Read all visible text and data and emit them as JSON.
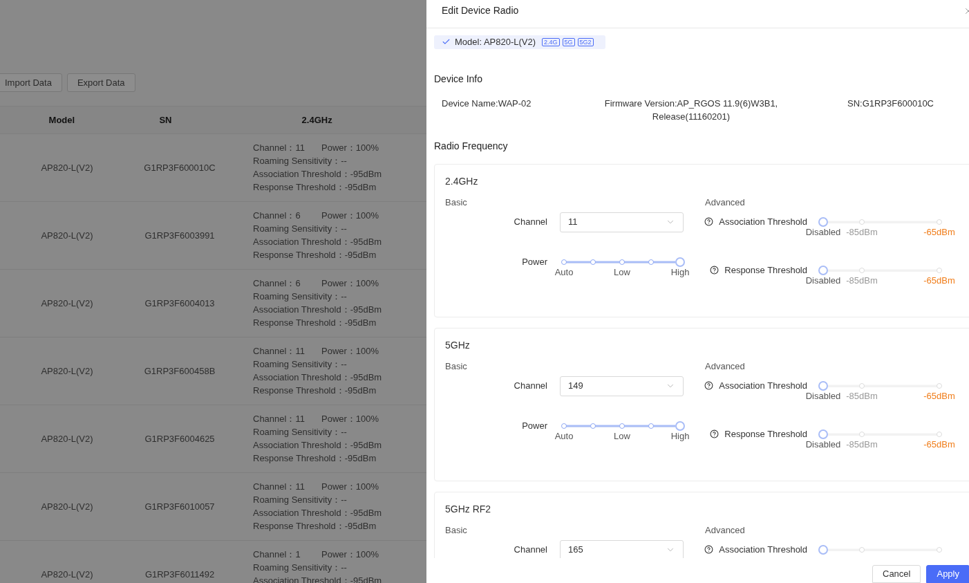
{
  "toolbar": {
    "buttons": [
      "Import Data",
      "Export Data"
    ]
  },
  "table": {
    "columns": [
      "Model",
      "SN",
      "2.4GHz"
    ],
    "rows": [
      {
        "model": "AP820-L(V2)",
        "sn": "G1RP3F600010C",
        "details": [
          "Channel：11",
          "Power：100%",
          "Roaming Sensitivity：--",
          "Association Threshold：-95dBm",
          "Response Threshold：-95dBm"
        ]
      },
      {
        "model": "AP820-L(V2)",
        "sn": "G1RP3F6003991",
        "details": [
          "Channel：6",
          "Power：100%",
          "Roaming Sensitivity：--",
          "Association Threshold：-95dBm",
          "Response Threshold：-95dBm"
        ]
      },
      {
        "model": "AP820-L(V2)",
        "sn": "G1RP3F6004013",
        "details": [
          "Channel：6",
          "Power：100%",
          "Roaming Sensitivity：--",
          "Association Threshold：-95dBm",
          "Response Threshold：-95dBm"
        ]
      },
      {
        "model": "AP820-L(V2)",
        "sn": "G1RP3F600458B",
        "details": [
          "Channel：11",
          "Power：100%",
          "Roaming Sensitivity：--",
          "Association Threshold：-95dBm",
          "Response Threshold：-95dBm"
        ]
      },
      {
        "model": "AP820-L(V2)",
        "sn": "G1RP3F6004625",
        "details": [
          "Channel：11",
          "Power：100%",
          "Roaming Sensitivity：--",
          "Association Threshold：-95dBm",
          "Response Threshold：-95dBm"
        ]
      },
      {
        "model": "AP820-L(V2)",
        "sn": "G1RP3F6010057",
        "details": [
          "Channel：11",
          "Power：100%",
          "Roaming Sensitivity：--",
          "Association Threshold：-95dBm",
          "Response Threshold：-95dBm"
        ]
      },
      {
        "model": "AP820-L(V2)",
        "sn": "G1RP3F6011492",
        "details": [
          "Channel：1",
          "Power：100%",
          "Roaming Sensitivity：--",
          "Association Threshold：-95dBm"
        ]
      }
    ]
  },
  "drawer": {
    "title": "Edit Device Radio",
    "model_chip": {
      "checked": true,
      "text": "Model: AP820-L(V2)",
      "tags": [
        "2.4G",
        "5G",
        "5G2"
      ]
    },
    "device_info": {
      "title": "Device Info",
      "fields": [
        "Device Name:WAP-02",
        "Firmware Version:AP_RGOS 11.9(6)W3B1, Release(11160201)",
        "SN:G1RP3F600010C"
      ]
    },
    "radio_title": "Radio Frequency",
    "radios": [
      {
        "title": "2.4GHz",
        "basic_label": "Basic",
        "advanced_label": "Advanced",
        "channel_label": "Channel",
        "channel_value": "11",
        "power": {
          "label": "Power",
          "level": 1,
          "marks": [
            {
              "text": "Auto"
            },
            {
              "text": "Low"
            },
            {
              "text": "High"
            }
          ]
        },
        "thresholds": [
          {
            "label": "Association Threshold",
            "level": 0,
            "marks": [
              {
                "text": "Disabled",
                "color": "#555555"
              },
              {
                "text": "-85dBm",
                "color": "#999999"
              },
              {
                "text": "-65dBm",
                "color": "#f07d1a"
              }
            ]
          },
          {
            "label": "Response Threshold",
            "level": 0,
            "marks": [
              {
                "text": "Disabled",
                "color": "#555555"
              },
              {
                "text": "-85dBm",
                "color": "#999999"
              },
              {
                "text": "-65dBm",
                "color": "#f07d1a"
              }
            ]
          }
        ]
      },
      {
        "title": "5GHz",
        "basic_label": "Basic",
        "advanced_label": "Advanced",
        "channel_label": "Channel",
        "channel_value": "149",
        "power": {
          "label": "Power",
          "level": 1,
          "marks": [
            {
              "text": "Auto"
            },
            {
              "text": "Low"
            },
            {
              "text": "High"
            }
          ]
        },
        "thresholds": [
          {
            "label": "Association Threshold",
            "level": 0,
            "marks": [
              {
                "text": "Disabled",
                "color": "#555555"
              },
              {
                "text": "-85dBm",
                "color": "#999999"
              },
              {
                "text": "-65dBm",
                "color": "#f07d1a"
              }
            ]
          },
          {
            "label": "Response Threshold",
            "level": 0,
            "marks": [
              {
                "text": "Disabled",
                "color": "#555555"
              },
              {
                "text": "-85dBm",
                "color": "#999999"
              },
              {
                "text": "-65dBm",
                "color": "#f07d1a"
              }
            ]
          }
        ]
      },
      {
        "title": "5GHz RF2",
        "basic_label": "Basic",
        "advanced_label": "Advanced",
        "channel_label": "Channel",
        "channel_value": "165",
        "thresholds": [
          {
            "label": "Association Threshold",
            "level": 0
          }
        ]
      }
    ],
    "footer": {
      "buttons": [
        "Cancel",
        "Apply"
      ]
    }
  }
}
